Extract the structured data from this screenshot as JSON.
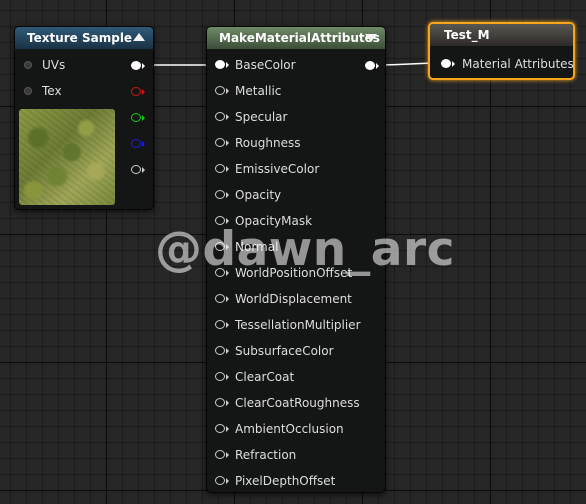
{
  "nodes": {
    "texture_sample": {
      "title": "Texture Sample",
      "inputs": [
        "UVs",
        "Tex"
      ]
    },
    "make_material_attributes": {
      "title": "MakeMaterialAttributes",
      "inputs": [
        "BaseColor",
        "Metallic",
        "Specular",
        "Roughness",
        "EmissiveColor",
        "Opacity",
        "OpacityMask",
        "Normal",
        "WorldPositionOffset",
        "WorldDisplacement",
        "TessellationMultiplier",
        "SubsurfaceColor",
        "ClearCoat",
        "ClearCoatRoughness",
        "AmbientOcclusion",
        "Refraction",
        "PixelDepthOffset"
      ]
    },
    "test_m": {
      "title": "Test_M",
      "inputs": [
        "Material Attributes"
      ]
    }
  },
  "watermark": "@dawn_arc",
  "colors": {
    "output_rgba": "#ffffff",
    "output_r": "#d31414",
    "output_g": "#18c818",
    "output_b": "#1f1fd6",
    "output_a": "#cccccc",
    "selection": "#f4a51c",
    "wire": "#ffffff"
  }
}
